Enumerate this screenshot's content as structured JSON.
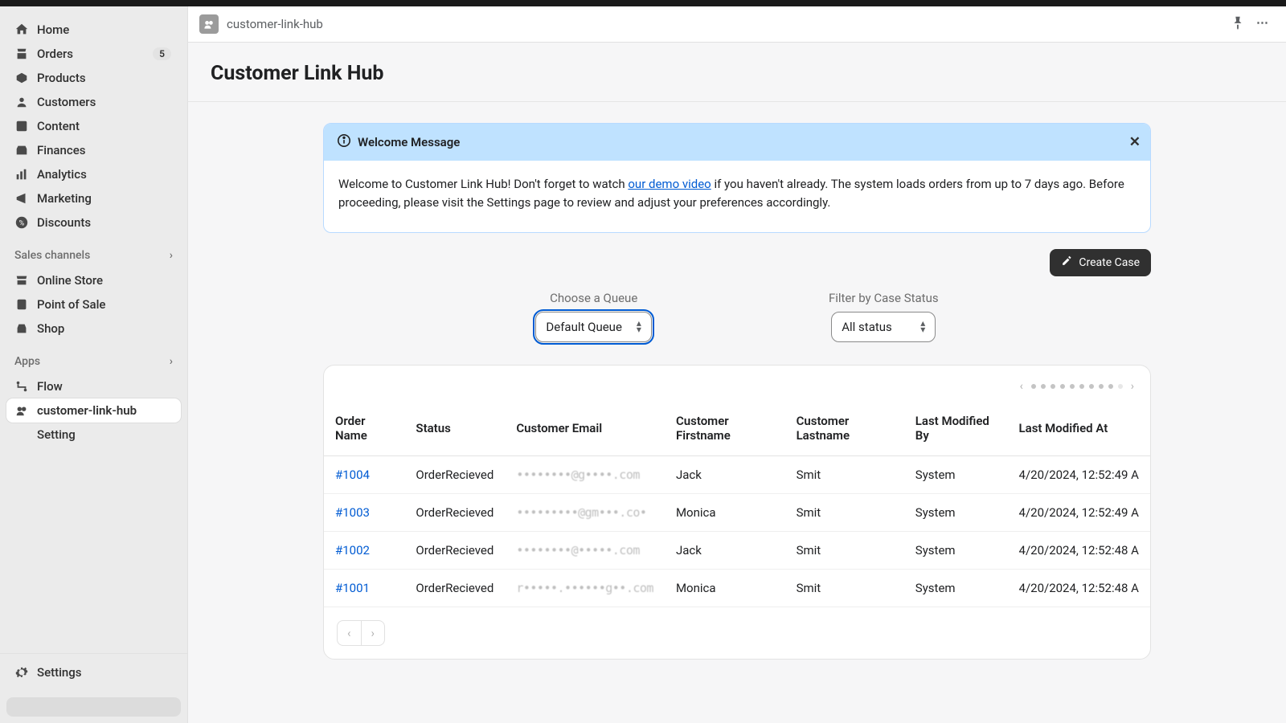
{
  "breadcrumb": "customer-link-hub",
  "page_title": "Customer Link Hub",
  "nav": {
    "main": [
      {
        "label": "Home"
      },
      {
        "label": "Orders",
        "badge": "5"
      },
      {
        "label": "Products"
      },
      {
        "label": "Customers"
      },
      {
        "label": "Content"
      },
      {
        "label": "Finances"
      },
      {
        "label": "Analytics"
      },
      {
        "label": "Marketing"
      },
      {
        "label": "Discounts"
      }
    ],
    "channels_header": "Sales channels",
    "channels": [
      {
        "label": "Online Store"
      },
      {
        "label": "Point of Sale"
      },
      {
        "label": "Shop"
      }
    ],
    "apps_header": "Apps",
    "apps": [
      {
        "label": "Flow"
      },
      {
        "label": "customer-link-hub"
      },
      {
        "label": "Setting"
      }
    ],
    "settings": "Settings"
  },
  "banner": {
    "title": "Welcome Message",
    "body_pre": "Welcome to Customer Link Hub! Don't forget to watch ",
    "body_link": "our demo video",
    "body_post": " if you haven't already. The system loads orders from up to 7 days ago. Before proceeding, please visit the Settings page to review and adjust your preferences accordingly."
  },
  "create_case": "Create Case",
  "filters": {
    "queue_label": "Choose a Queue",
    "queue_value": "Default Queue",
    "status_label": "Filter by Case Status",
    "status_value": "All status"
  },
  "table": {
    "headers": [
      "Order Name",
      "Status",
      "Customer Email",
      "Customer Firstname",
      "Customer Lastname",
      "Last Modified By",
      "Last Modified At"
    ],
    "rows": [
      {
        "order": "#1004",
        "status": "OrderRecieved",
        "email": "••••••••@g••••.com",
        "first": "Jack",
        "last": "Smit",
        "by": "System",
        "at": "4/20/2024, 12:52:49 A"
      },
      {
        "order": "#1003",
        "status": "OrderRecieved",
        "email": "•••••••••@gm•••.co•",
        "first": "Monica",
        "last": "Smit",
        "by": "System",
        "at": "4/20/2024, 12:52:49 A"
      },
      {
        "order": "#1002",
        "status": "OrderRecieved",
        "email": "••••••••@•••••.com",
        "first": "Jack",
        "last": "Smit",
        "by": "System",
        "at": "4/20/2024, 12:52:48 A"
      },
      {
        "order": "#1001",
        "status": "OrderRecieved",
        "email": "r•••••.••••••g••.com",
        "first": "Monica",
        "last": "Smit",
        "by": "System",
        "at": "4/20/2024, 12:52:48 A"
      }
    ]
  }
}
